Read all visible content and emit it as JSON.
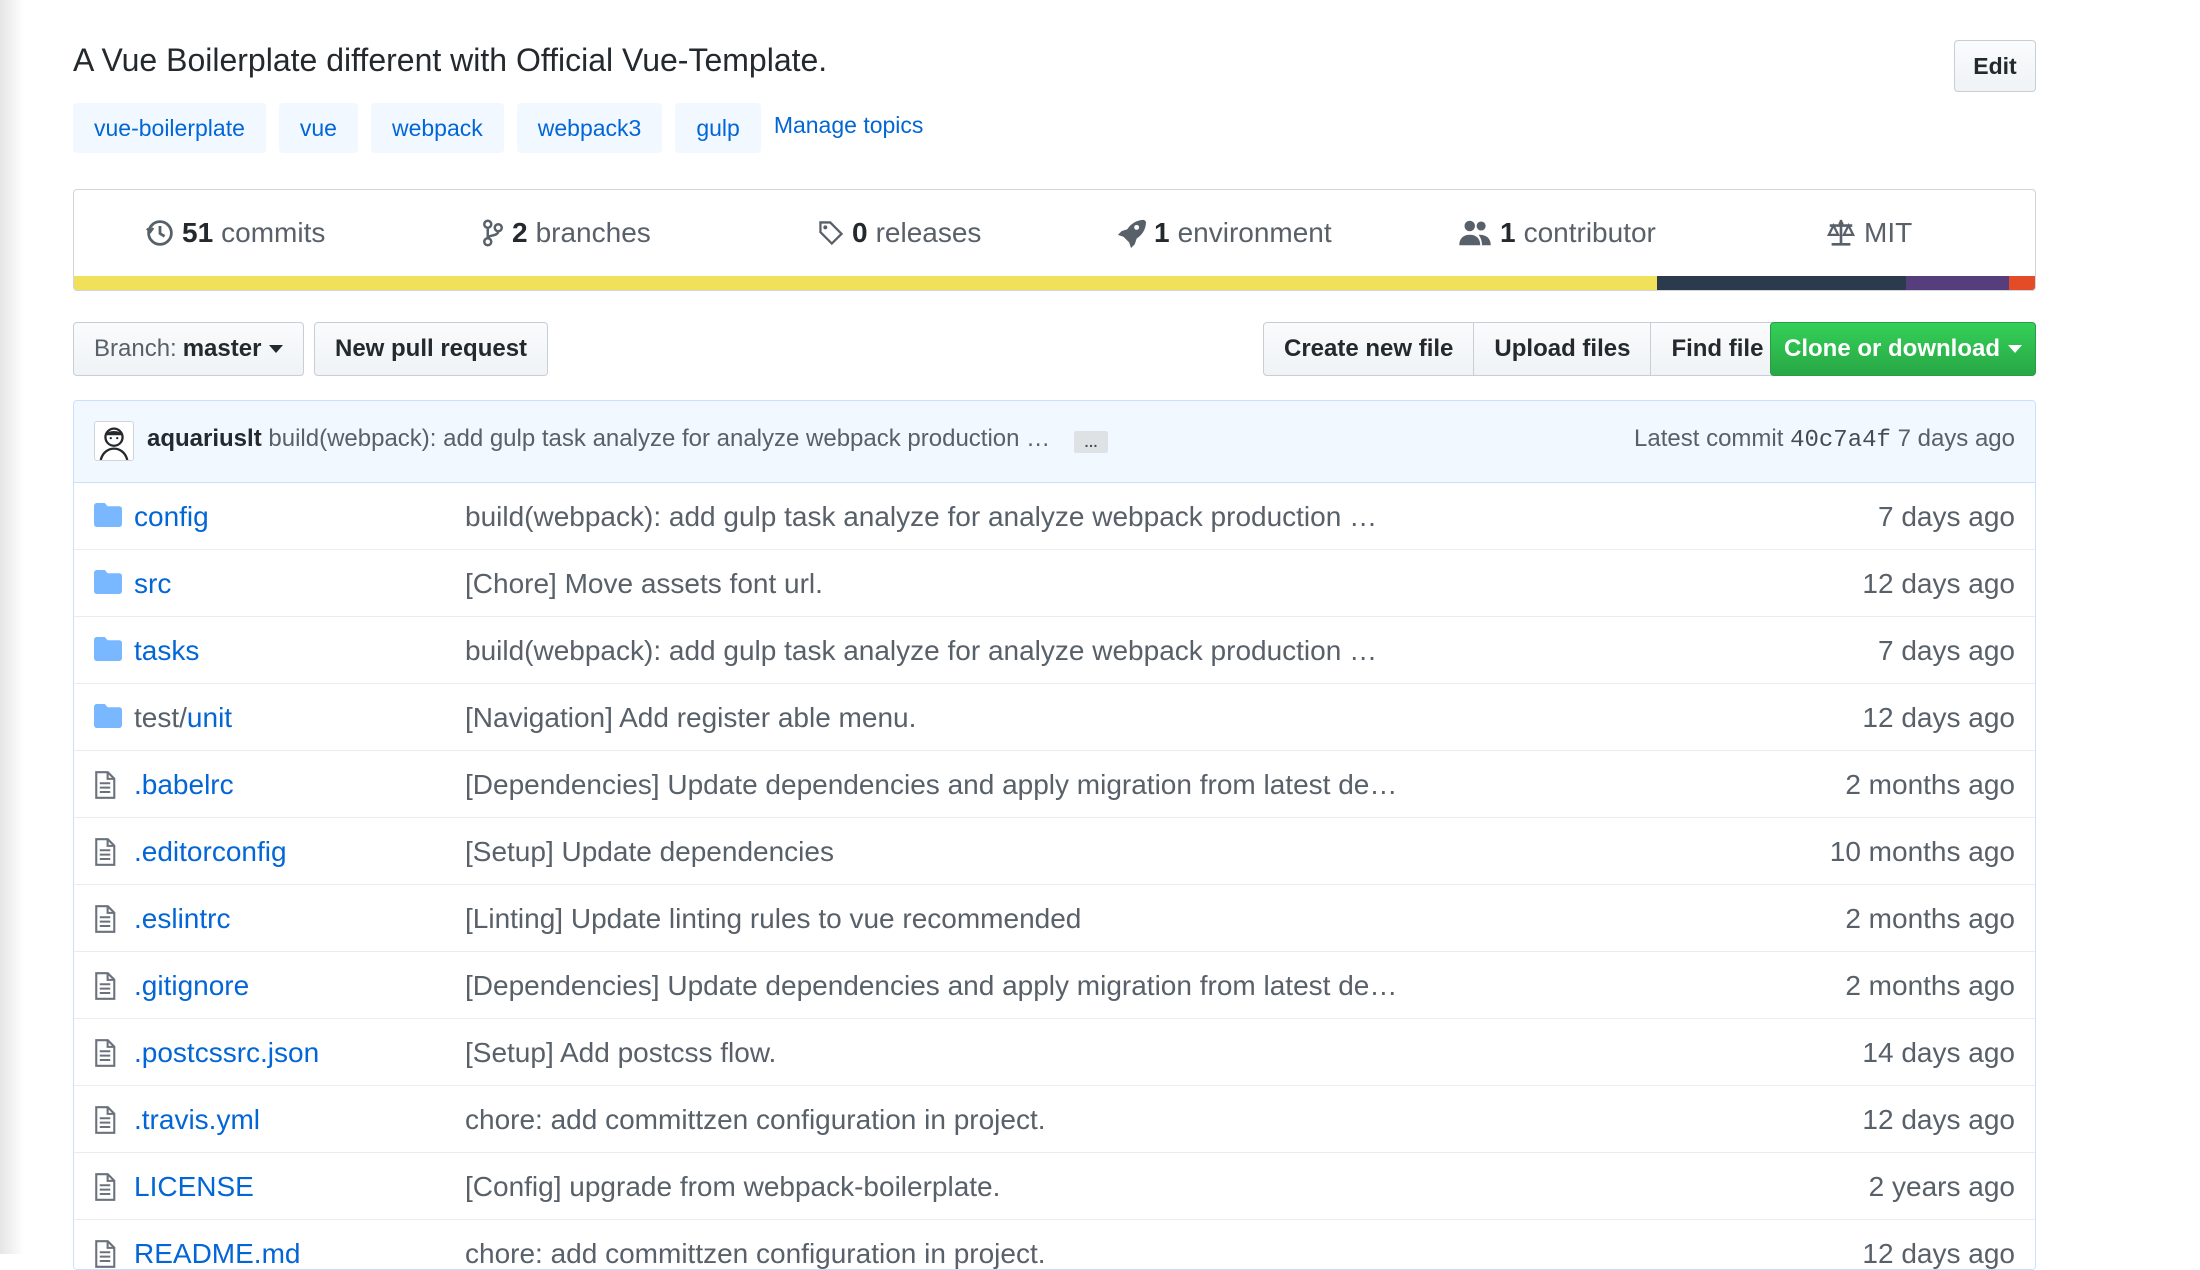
{
  "repo": {
    "description": "A Vue Boilerplate different with Official Vue-Template.",
    "edit_label": "Edit",
    "topics": [
      "vue-boilerplate",
      "vue",
      "webpack",
      "webpack3",
      "gulp"
    ],
    "manage_topics_label": "Manage topics"
  },
  "summary": {
    "commits": {
      "count": "51",
      "label": "commits",
      "icon": "history-icon"
    },
    "branches": {
      "count": "2",
      "label": "branches",
      "icon": "branch-icon"
    },
    "releases": {
      "count": "0",
      "label": "releases",
      "icon": "tag-icon"
    },
    "environments": {
      "count": "1",
      "label": "environment",
      "icon": "rocket-icon"
    },
    "contributors": {
      "count": "1",
      "label": "contributor",
      "icon": "people-icon"
    },
    "license": {
      "label": "MIT",
      "icon": "law-icon"
    },
    "languages": [
      {
        "share": 0.807,
        "color": "#f1e05a"
      },
      {
        "share": 0.127,
        "color": "#2b3a4c"
      },
      {
        "share": 0.053,
        "color": "#563d7c"
      },
      {
        "share": 0.013,
        "color": "#e34c26"
      }
    ]
  },
  "toolbar": {
    "branch_prefix": "Branch:",
    "branch_name": "master",
    "new_pull_request": "New pull request",
    "create_new_file": "Create new file",
    "upload_files": "Upload files",
    "find_file": "Find file",
    "clone_or_download": "Clone or download"
  },
  "latest_commit": {
    "author": "aquariuslt",
    "message": "build(webpack): add gulp task analyze for analyze webpack production …",
    "ellipsis": "…",
    "prefix": "Latest commit",
    "sha": "40c7a4f",
    "age": "7 days ago"
  },
  "files": [
    {
      "type": "dir",
      "name": "config",
      "message": "build(webpack): add gulp task analyze for analyze webpack production …",
      "age": "7 days ago"
    },
    {
      "type": "dir",
      "name": "src",
      "message": "[Chore] Move assets font url.",
      "age": "12 days ago"
    },
    {
      "type": "dir",
      "name": "tasks",
      "message": "build(webpack): add gulp task analyze for analyze webpack production …",
      "age": "7 days ago"
    },
    {
      "type": "dir",
      "name_prefix": "test/",
      "name": "unit",
      "message": "[Navigation] Add register able menu.",
      "age": "12 days ago"
    },
    {
      "type": "file",
      "name": ".babelrc",
      "message": "[Dependencies] Update dependencies and apply migration from latest de…",
      "age": "2 months ago"
    },
    {
      "type": "file",
      "name": ".editorconfig",
      "message": "[Setup] Update dependencies",
      "age": "10 months ago"
    },
    {
      "type": "file",
      "name": ".eslintrc",
      "message": "[Linting] Update linting rules to vue recommended",
      "age": "2 months ago"
    },
    {
      "type": "file",
      "name": ".gitignore",
      "message": "[Dependencies] Update dependencies and apply migration from latest de…",
      "age": "2 months ago"
    },
    {
      "type": "file",
      "name": ".postcssrc.json",
      "message": "[Setup] Add postcss flow.",
      "age": "14 days ago"
    },
    {
      "type": "file",
      "name": ".travis.yml",
      "message": "chore: add committzen configuration in project.",
      "age": "12 days ago"
    },
    {
      "type": "file",
      "name": "LICENSE",
      "message": "[Config] upgrade from webpack-boilerplate.",
      "age": "2 years ago"
    },
    {
      "type": "file",
      "name": "README.md",
      "message": "chore: add committzen configuration in project.",
      "age": "12 days ago"
    }
  ],
  "colors": {
    "link": "#0366d6",
    "muted": "#586069",
    "topic_bg": "#f1f8ff",
    "clone_green": "#28a745",
    "folder_icon": "#79b8ff",
    "file_icon": "#6a737d"
  }
}
